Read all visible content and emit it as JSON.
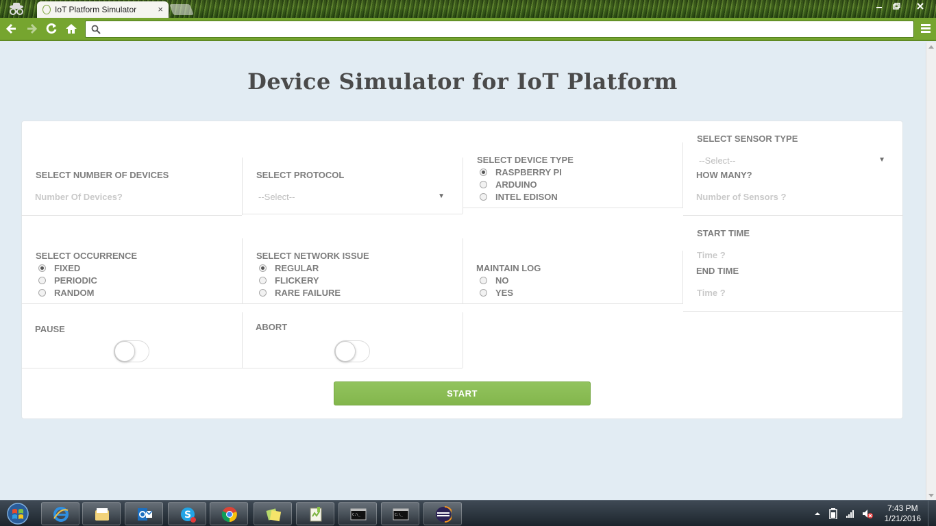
{
  "browser": {
    "tab_title": "IoT Platform Simulator",
    "tab_close": "×",
    "omnibox_value": ""
  },
  "page": {
    "title": "Device Simulator for IoT Platform"
  },
  "form": {
    "num_devices": {
      "label": "SELECT NUMBER OF DEVICES",
      "placeholder": "Number Of Devices?"
    },
    "protocol": {
      "label": "SELECT PROTOCOL",
      "selected": "--Select--"
    },
    "device_type": {
      "label": "SELECT DEVICE TYPE",
      "options": [
        {
          "label": "RASPBERRY PI",
          "checked": true
        },
        {
          "label": "ARDUINO",
          "checked": false
        },
        {
          "label": "INTEL EDISON",
          "checked": false
        }
      ]
    },
    "sensor_type": {
      "label": "SELECT SENSOR TYPE",
      "selected": "--Select--"
    },
    "how_many": {
      "label": "HOW MANY?",
      "placeholder": "Number of Sensors ?"
    },
    "occurrence": {
      "label": "SELECT OCCURRENCE",
      "options": [
        {
          "label": "FIXED",
          "checked": true
        },
        {
          "label": "PERIODIC",
          "checked": false
        },
        {
          "label": "RANDOM",
          "checked": false
        }
      ]
    },
    "network_issue": {
      "label": "SELECT NETWORK ISSUE",
      "options": [
        {
          "label": "REGULAR",
          "checked": true
        },
        {
          "label": "FLICKERY",
          "checked": false
        },
        {
          "label": "RARE FAILURE",
          "checked": false
        }
      ]
    },
    "maintain_log": {
      "label": "MAINTAIN LOG",
      "options": [
        {
          "label": "NO",
          "checked": false
        },
        {
          "label": "YES",
          "checked": false
        }
      ]
    },
    "start_time": {
      "label": "START TIME",
      "placeholder": "Time ?"
    },
    "end_time": {
      "label": "END TIME",
      "placeholder": "Time ?"
    },
    "pause": {
      "label": "PAUSE",
      "on": false
    },
    "abort": {
      "label": "ABORT",
      "on": false
    },
    "start_button": "START"
  },
  "taskbar": {
    "time": "7:43 PM",
    "date": "1/21/2016",
    "apps": [
      "internet-explorer",
      "file-explorer",
      "outlook",
      "skype",
      "chrome",
      "sticky-notes",
      "notepad-plus-plus",
      "command-prompt",
      "command-prompt",
      "eclipse"
    ]
  },
  "colors": {
    "accent": "#83b64c",
    "toolbar": "#76a52f",
    "background": "#e2ecf3",
    "label": "#7d7d7d",
    "placeholder": "#c9c9c9"
  }
}
